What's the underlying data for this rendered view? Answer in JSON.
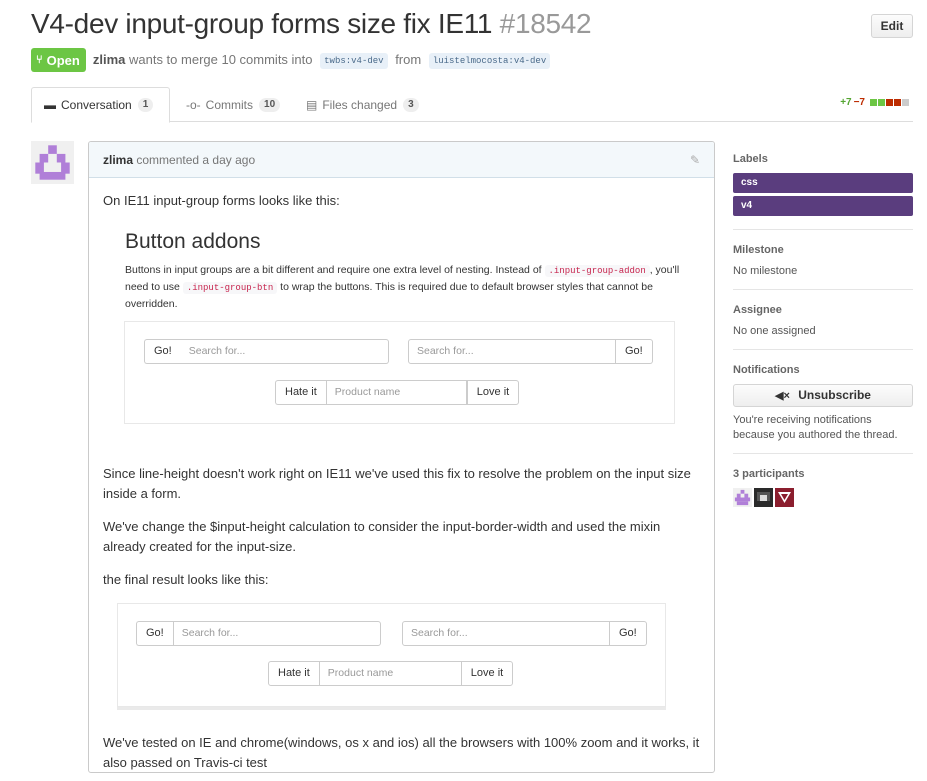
{
  "pr": {
    "title": "V4-dev input-group forms size fix IE11",
    "number": "#18542",
    "edit_label": "Edit",
    "state": "Open",
    "author": "zlima",
    "merge_text": "wants to merge 10 commits into",
    "base_branch": "twbs:v4-dev",
    "from_text": "from",
    "head_branch": "luistelmocosta:v4-dev"
  },
  "tabs": [
    {
      "label": "Conversation",
      "count": "1",
      "icon": "comment-icon"
    },
    {
      "label": "Commits",
      "count": "10",
      "icon": "commit-icon"
    },
    {
      "label": "Files changed",
      "count": "3",
      "icon": "file-diff-icon"
    }
  ],
  "diffstat": {
    "additions": "+7",
    "deletions": "−7"
  },
  "comment": {
    "author": "zlima",
    "action": "commented",
    "time": "a day ago",
    "p1": "On IE11 input-group forms looks like this:",
    "p2": "Since line-height doesn't work right on IE11 we've used this fix to resolve the problem on the input size inside a form.",
    "p3": "We've change the $input-height calculation to consider the input-border-width and used the mixin already created for the input-size.",
    "p4": "the final result looks like this:",
    "p5": "We've tested on IE and chrome(windows, os x and ios) all the browsers with 100% zoom and it works, it also passed on Travis-ci test"
  },
  "shot1": {
    "heading": "Button addons",
    "desc_a": "Buttons in input groups are a bit different and require one extra level of nesting. Instead of",
    "code_a": ".input-group-addon",
    "desc_b": ", you'll need to use",
    "code_b": ".input-group-btn",
    "desc_c": "to wrap the buttons. This is required due to default browser styles that cannot be overridden."
  },
  "demo": {
    "go": "Go!",
    "search_placeholder": "Search for...",
    "hate": "Hate it",
    "product_placeholder": "Product name",
    "love": "Love it"
  },
  "sidebar": {
    "labels_title": "Labels",
    "labels": [
      "css",
      "v4"
    ],
    "label_color": "#5a3d7e",
    "milestone_title": "Milestone",
    "milestone_value": "No milestone",
    "assignee_title": "Assignee",
    "assignee_value": "No one assigned",
    "notifications_title": "Notifications",
    "unsubscribe_label": "Unsubscribe",
    "notifications_reason": "You're receiving notifications because you authored the thread.",
    "participants_title": "3 participants"
  },
  "colors": {
    "open_green": "#6cc644",
    "addition_green": "#55a532",
    "deletion_red": "#bd2c00"
  }
}
